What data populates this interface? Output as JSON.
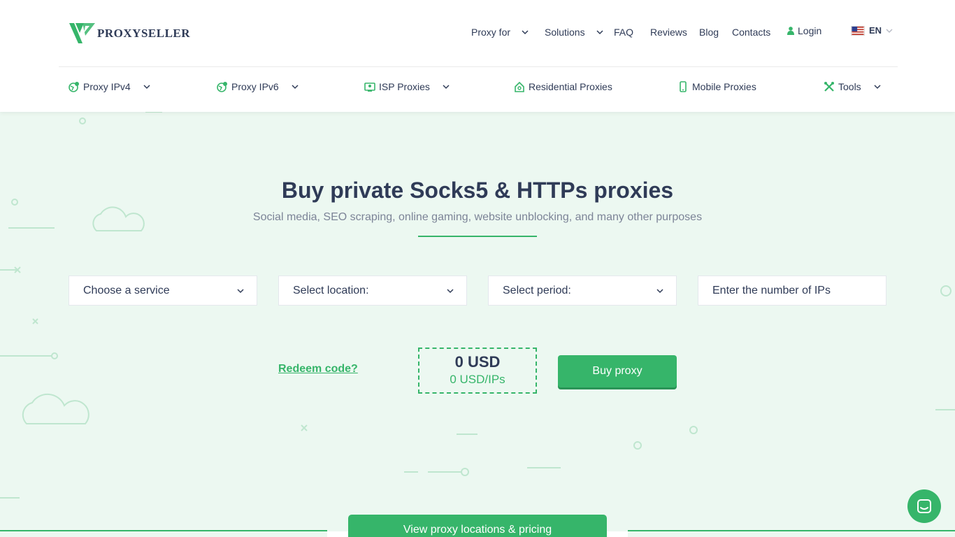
{
  "brand": {
    "name": "PROXYSELLER",
    "color": "#36b56a"
  },
  "topnav": {
    "proxy_for": "Proxy for",
    "solutions": "Solutions",
    "faq": "FAQ",
    "reviews": "Reviews",
    "blog": "Blog",
    "contacts": "Contacts",
    "login": "Login",
    "language": "EN"
  },
  "catnav": {
    "ipv4": "Proxy IPv4",
    "ipv6": "Proxy IPv6",
    "isp": "ISP Proxies",
    "residential": "Residential Proxies",
    "mobile": "Mobile Proxies",
    "tools": "Tools"
  },
  "hero": {
    "title": "Buy private Socks5 & HTTPs proxies",
    "subtitle": "Social media, SEO scraping, online gaming, website unblocking, and many other purposes"
  },
  "form": {
    "service": "Choose a service",
    "location": "Select location:",
    "period": "Select period:",
    "ip_count_placeholder": "Enter the number of IPs",
    "redeem": "Redeem code?",
    "price_total": "0 USD",
    "price_per": "0 USD/IPs",
    "buy": "Buy proxy"
  },
  "footer_cta": {
    "view_pricing": "View proxy locations & pricing"
  },
  "icons": {
    "logo": "proxyseller-logo-icon",
    "chevron": "chevron-down-icon",
    "login": "user-icon",
    "flag": "us-flag-icon",
    "ipv4": "globe-pin-icon",
    "ipv6": "globe-pin-icon",
    "isp": "server-icon",
    "residential": "house-icon",
    "mobile": "phone-icon",
    "tools": "tools-icon",
    "chat": "chat-icon"
  }
}
